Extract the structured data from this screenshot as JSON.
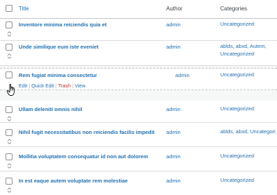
{
  "header": {
    "title_label": "Title",
    "author_label": "Author",
    "categories_label": "Categories"
  },
  "rows": [
    {
      "title": "Inventore minima reiciendis quia et",
      "author": "admin",
      "categories": [
        "Uncategorized"
      ]
    },
    {
      "title": "Unde similique eum iste eveniet",
      "author": "admin",
      "categories": [
        "ablds, abxd, Autem,",
        "Uncategorized"
      ]
    },
    {
      "title": "Rem fugiat minima consectetur",
      "author": "admin",
      "categories": [
        "Uncategorized"
      ]
    },
    {
      "title": "Ullam deleniti omnis nihil",
      "author": "admin",
      "categories": [
        "Uncategorized"
      ]
    },
    {
      "title": "Nihil fugit necessitatibus non reiciendis facilis impedit",
      "author": "admin",
      "categories": [
        "ablds, abxd, Uncategori"
      ]
    },
    {
      "title": "Mollitia voluptatem consequatur id non aut dolorem",
      "author": "admin",
      "categories": [
        "Uncategorized"
      ]
    },
    {
      "title": "In est eaque autem voluptate rem molestiae",
      "author": "admin",
      "categories": [
        "Uncategorized"
      ]
    }
  ],
  "row_actions": {
    "edit": "Edit",
    "quick_edit": "Quick Edit",
    "trash": "Trash",
    "view": "View",
    "separator": "|"
  },
  "icons": {
    "drag_handle": "drag-handle-icon",
    "cursor": "grab-cursor-icon"
  },
  "colors": {
    "link": "#2271b1",
    "trash": "#b32d2e",
    "text": "#3c434a",
    "border": "#c3c4c7"
  }
}
